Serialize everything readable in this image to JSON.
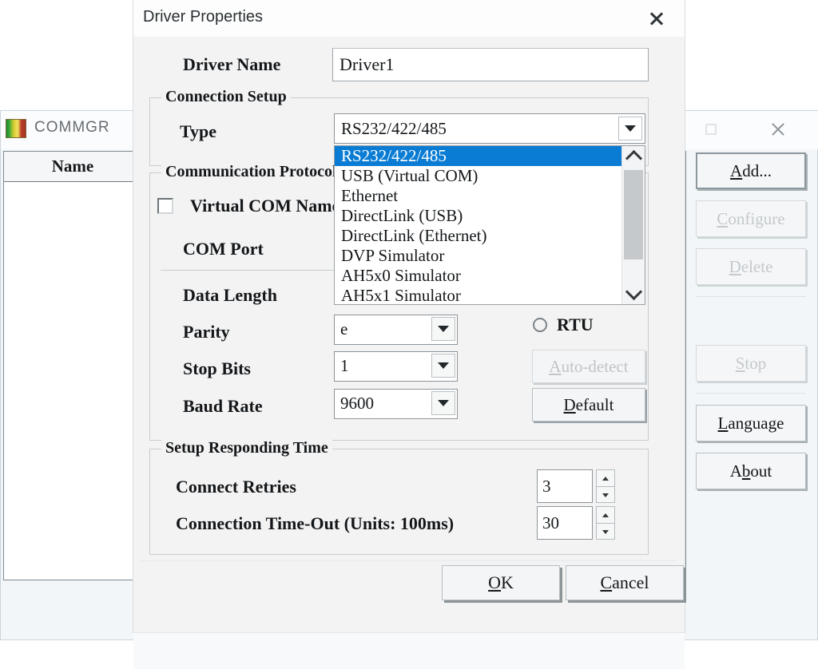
{
  "commgr": {
    "title": "COMMGR",
    "app_icon": "commgr-logo-icon",
    "maximize_icon": "maximize-icon",
    "close_icon": "close-icon",
    "list": {
      "columns": [
        "Name"
      ],
      "rows": []
    },
    "buttons": [
      {
        "id": "add",
        "label": "Add...",
        "mnemonic": "A",
        "enabled": true
      },
      {
        "id": "configure",
        "label": "Configure",
        "mnemonic": "C",
        "enabled": false
      },
      {
        "id": "delete",
        "label": "Delete",
        "mnemonic": "D",
        "enabled": false
      },
      {
        "id": "stop",
        "label": "Stop",
        "mnemonic": "S",
        "enabled": false
      },
      {
        "id": "language",
        "label": "Language",
        "mnemonic": "L",
        "enabled": true
      },
      {
        "id": "about",
        "label": "About",
        "mnemonic": "b",
        "enabled": true
      }
    ],
    "button_labels": {
      "add": "Add...",
      "configure": "Configure",
      "delete": "Delete",
      "stop": "Stop",
      "language": "Language",
      "about": "About"
    }
  },
  "dialog": {
    "title": "Driver Properties",
    "close_icon": "close-icon",
    "driver_name": {
      "label": "Driver Name",
      "value": "Driver1"
    },
    "connection_setup": {
      "legend": "Connection Setup",
      "type": {
        "label": "Type",
        "value": "RS232/422/485",
        "expanded": true,
        "selected_index": 0,
        "options": [
          "RS232/422/485",
          "USB (Virtual COM)",
          "Ethernet",
          "DirectLink (USB)",
          "DirectLink (Ethernet)",
          "DVP Simulator",
          "AH5x0 Simulator",
          "AH5x1 Simulator"
        ]
      }
    },
    "communication_protocol": {
      "legend": "Communication Protocol",
      "virtual_com_name": {
        "label": "Virtual COM Name",
        "checked": false
      },
      "com_port": {
        "label": "COM Port"
      },
      "data_length": {
        "label": "Data Length"
      },
      "parity": {
        "label": "Parity",
        "value": "e"
      },
      "stop_bits": {
        "label": "Stop Bits",
        "value": "1"
      },
      "baud_rate": {
        "label": "Baud Rate",
        "value": "9600"
      },
      "rtu": {
        "label": "RTU",
        "selected": false
      },
      "auto_detect": {
        "label": "Auto-detect",
        "mnemonic": "A",
        "enabled": false
      },
      "default": {
        "label": "Default",
        "mnemonic": "D",
        "enabled": true
      }
    },
    "setup_responding_time": {
      "legend": "Setup Responding Time",
      "connect_retries": {
        "label": "Connect Retries",
        "value": "3"
      },
      "connection_timeout": {
        "label": "Connection Time-Out (Units: 100ms)",
        "value": "30"
      }
    },
    "footer": {
      "ok": "OK",
      "cancel": "Cancel"
    }
  },
  "colors": {
    "selection_blue": "#0a7cd4",
    "dialog_bg": "#f3f3f3",
    "window_bg": "#f3f6f8",
    "text": "#14171a"
  }
}
